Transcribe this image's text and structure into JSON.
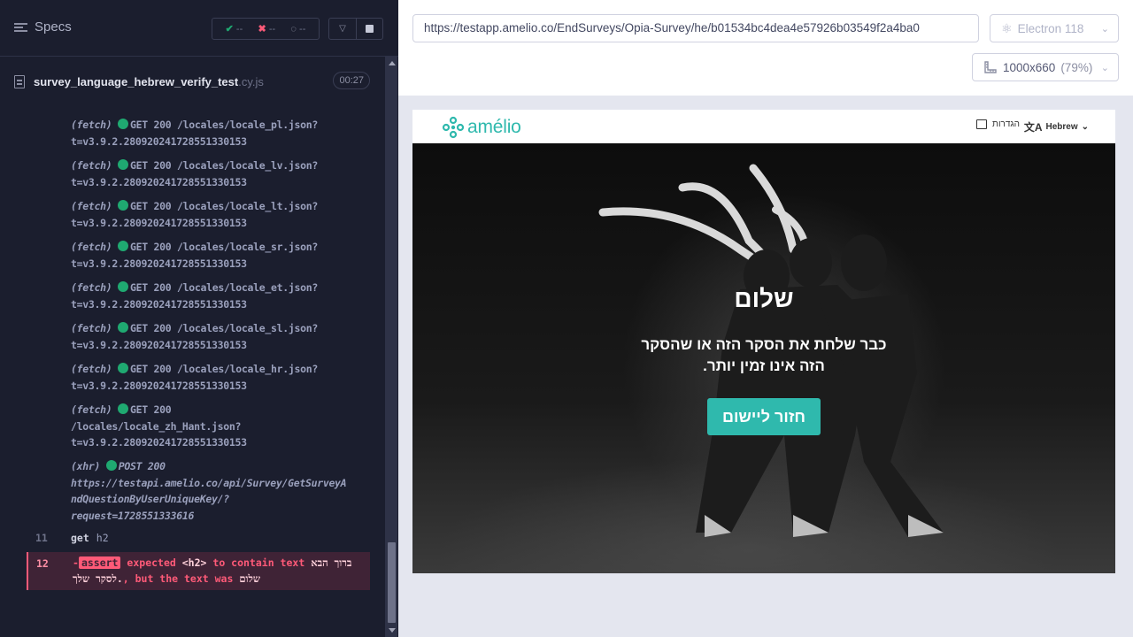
{
  "reporter": {
    "specs_label": "Specs",
    "stats": {
      "passed": "--",
      "failed": "--",
      "pending": "--"
    },
    "file": {
      "name": "survey_language_hebrew_verify_test",
      "ext": ".cy.js",
      "duration": "00:27"
    },
    "logs": [
      {
        "type": "(fetch)",
        "line1": "GET 200 /locales/locale_pl.json?",
        "line2": "t=v3.9.2.28092024172855133015​3"
      },
      {
        "type": "(fetch)",
        "line1": "GET 200 /locales/locale_lv.json?",
        "line2": "t=v3.9.2.28092024172855133015​3"
      },
      {
        "type": "(fetch)",
        "line1": "GET 200 /locales/locale_lt.json?",
        "line2": "t=v3.9.2.28092024172855133015​3"
      },
      {
        "type": "(fetch)",
        "line1": "GET 200 /locales/locale_sr.json?",
        "line2": "t=v3.9.2.28092024172855133015​3"
      },
      {
        "type": "(fetch)",
        "line1": "GET 200 /locales/locale_et.json?",
        "line2": "t=v3.9.2.28092024172855133015​3"
      },
      {
        "type": "(fetch)",
        "line1": "GET 200 /locales/locale_sl.json?",
        "line2": "t=v3.9.2.28092024172855133015​3"
      },
      {
        "type": "(fetch)",
        "line1": "GET 200 /locales/locale_hr.json?",
        "line2": "t=v3.9.2.28092024172855133015​3"
      }
    ],
    "log_zh": {
      "type": "(fetch)",
      "line1": "GET 200",
      "line2": "/locales/locale_zh_Hant.json?",
      "line3": "t=v3.9.2.28092024172855133015​3"
    },
    "log_xhr": {
      "type": "(xhr)",
      "line1": "POST 200",
      "line2": "https://testapi.amelio.co/api/Survey/GetSurveyA",
      "line3": "ndQuestionByUserUniqueKey/?",
      "line4": "request=1728551333616"
    },
    "cmd_get": {
      "num": "11",
      "name": "get",
      "arg": "h2"
    },
    "cmd_assert": {
      "num": "12",
      "prefix": "-",
      "badge": "assert",
      "expected": "expected",
      "tag": "<h2>",
      "contain": "to contain text",
      "expected_text": "ברוך הבא לסקר שלך.",
      "but": ", but the text was",
      "actual_text": "שלום"
    }
  },
  "aut": {
    "url": "https://testapp.amelio.co/EndSurveys/Opia-Survey/he/b01534bc4dea4e57926b03549f2a4ba0",
    "browser": "Electron 118",
    "viewport": "1000x660",
    "viewport_pct": "(79%)",
    "app": {
      "logo_text": "amélio",
      "settings": "הגדרות",
      "language": "Hebrew",
      "title": "שלום",
      "message": "כבר שלחת את הסקר הזה או שהסקר הזה אינו זמין יותר.",
      "back_button": "חזור ליישום"
    }
  },
  "colors": {
    "accent": "#2fb9ad",
    "pass": "#1fa971",
    "fail": "#ff5a78",
    "panel_bg": "#1b1e2e"
  }
}
